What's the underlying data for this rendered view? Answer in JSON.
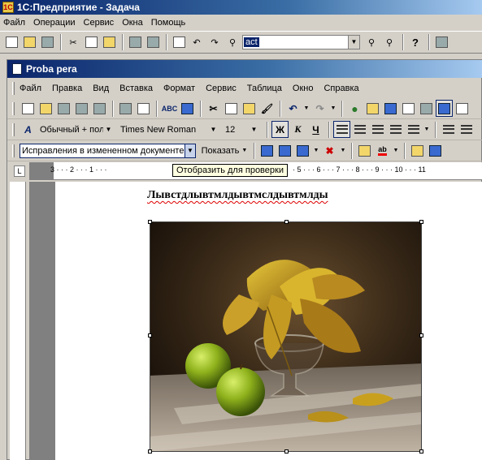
{
  "app": {
    "title": "1С:Предприятие - Задача",
    "menu": [
      "Файл",
      "Операции",
      "Сервис",
      "Окна",
      "Помощь"
    ],
    "combo_value": "act"
  },
  "doc_window": {
    "title": "Proba pera",
    "menu": [
      "Файл",
      "Правка",
      "Вид",
      "Вставка",
      "Формат",
      "Сервис",
      "Таблица",
      "Окно",
      "Справка"
    ]
  },
  "formatting": {
    "style": "Обычный + пол",
    "font": "Times New Roman",
    "size": "12",
    "bold": "Ж",
    "italic": "К",
    "underline": "Ч"
  },
  "reviewing": {
    "display_mode": "Исправления в измененном документе",
    "show_label": "Показать"
  },
  "tooltip": "Отобразить для проверки",
  "ruler": {
    "corner": "L",
    "numbers": "3 · · · 2 · · · 1 · · ·",
    "numbers_right": "· 5 · · · 6 · · · 7 · · · 8 · · · 9 · · · 10 · · · 11"
  },
  "document": {
    "heading": "Лывстдлывтмлдывтмслдывтмлды"
  },
  "colors": {
    "title_start": "#0a246a",
    "title_end": "#a6caf0",
    "chrome": "#d4d0c8"
  }
}
